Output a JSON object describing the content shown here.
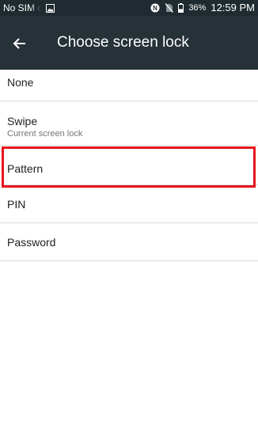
{
  "status_bar": {
    "carrier": "No SIM card",
    "battery_percent": "36%",
    "time": "12:59 PM",
    "icons": [
      "image-notification-icon",
      "nfc-icon",
      "no-sim-icon",
      "battery-icon"
    ]
  },
  "toolbar": {
    "back_icon": "arrow-left-icon",
    "title": "Choose screen lock"
  },
  "options": [
    {
      "label": "None"
    },
    {
      "label": "Swipe",
      "summary": "Current screen lock"
    },
    {
      "label": "Pattern",
      "highlighted": true
    },
    {
      "label": "PIN"
    },
    {
      "label": "Password"
    }
  ],
  "colors": {
    "status_bar": "#1f2b30",
    "toolbar": "#263238",
    "highlight": "#e8141b",
    "divider": "#dcdcdc",
    "primary_text": "#212121",
    "secondary_text": "#757575"
  }
}
